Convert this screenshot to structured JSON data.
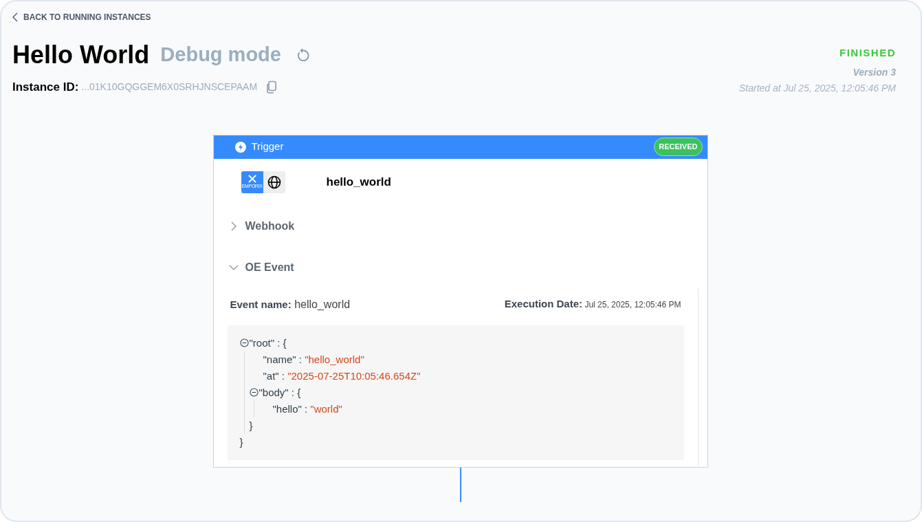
{
  "back_link": {
    "label": "BACK TO RUNNING INSTANCES"
  },
  "header": {
    "title": "Hello World",
    "mode": "Debug mode",
    "instance_label": "Instance ID:",
    "instance_id": "...01K10GQGGEM6X0SRHJNSCEPAAM",
    "status": "FINISHED",
    "version": "Version 3",
    "started": "Started at Jul 25, 2025, 12:05:46 PM"
  },
  "trigger": {
    "title": "Trigger",
    "badge": "RECEIVED",
    "logo_caption": "EMPORIX",
    "name": "hello_world",
    "sections": [
      {
        "label": "Webhook",
        "expanded": false
      },
      {
        "label": "OE Event",
        "expanded": true,
        "event_label": "Event name:",
        "event_name": "hello_world",
        "date_label": "Execution Date:",
        "date": "Jul 25, 2025, 12:05:46 PM",
        "json": {
          "separator": ":",
          "root": {
            "key": "\"root\"",
            "open": "{",
            "close": "}",
            "expanded": true,
            "children": [
              {
                "key": "\"name\"",
                "value": "\"hello_world\""
              },
              {
                "key": "\"at\"",
                "value": "\"2025-07-25T10:05:46.654Z\""
              },
              {
                "key": "\"body\"",
                "open": "{",
                "close": "}",
                "expanded": true,
                "children": [
                  {
                    "key": "\"hello\"",
                    "value": "\"world\""
                  }
                ]
              }
            ]
          }
        }
      }
    ]
  }
}
